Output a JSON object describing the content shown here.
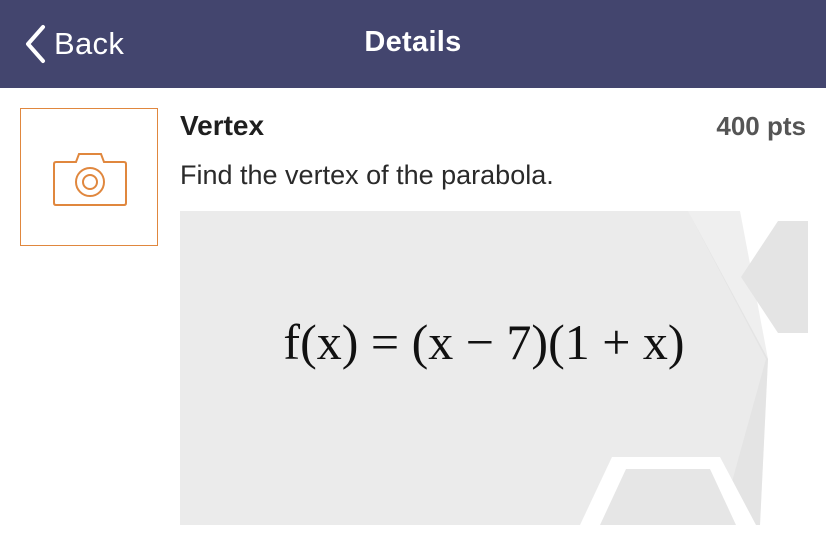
{
  "navbar": {
    "back_label": "Back",
    "title": "Details",
    "background_color": "#43456e",
    "back_icon": "chevron-left-icon"
  },
  "photo": {
    "icon": "camera-icon",
    "accent_color": "#e0873e"
  },
  "question": {
    "title": "Vertex",
    "points": "400 pts",
    "description": "Find the vertex of the parabola.",
    "equation": "f(x) = (x − 7)(1 + x)"
  }
}
